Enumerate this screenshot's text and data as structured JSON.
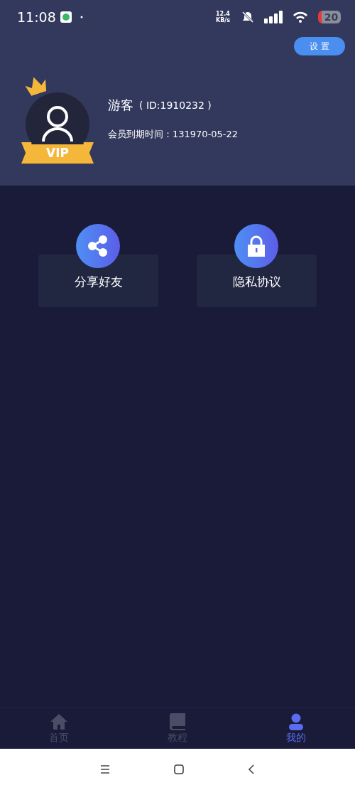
{
  "status_bar": {
    "time": "11:08",
    "net_speed": [
      "12.4",
      "KB/s"
    ],
    "battery": "20"
  },
  "settings_button": "设 置",
  "profile": {
    "name": "游客",
    "id": "( ID:1910232 )",
    "badge": "VIP",
    "expiry": "会员到期时间：131970-05-22"
  },
  "actions": [
    {
      "kind": "share",
      "label": "分享好友"
    },
    {
      "kind": "privacy",
      "label": "隐私协议"
    }
  ],
  "tabs": [
    {
      "kind": "home",
      "label": "首页",
      "selected": false
    },
    {
      "kind": "book",
      "label": "教程",
      "selected": false
    },
    {
      "kind": "user",
      "label": "我的",
      "selected": true
    }
  ]
}
